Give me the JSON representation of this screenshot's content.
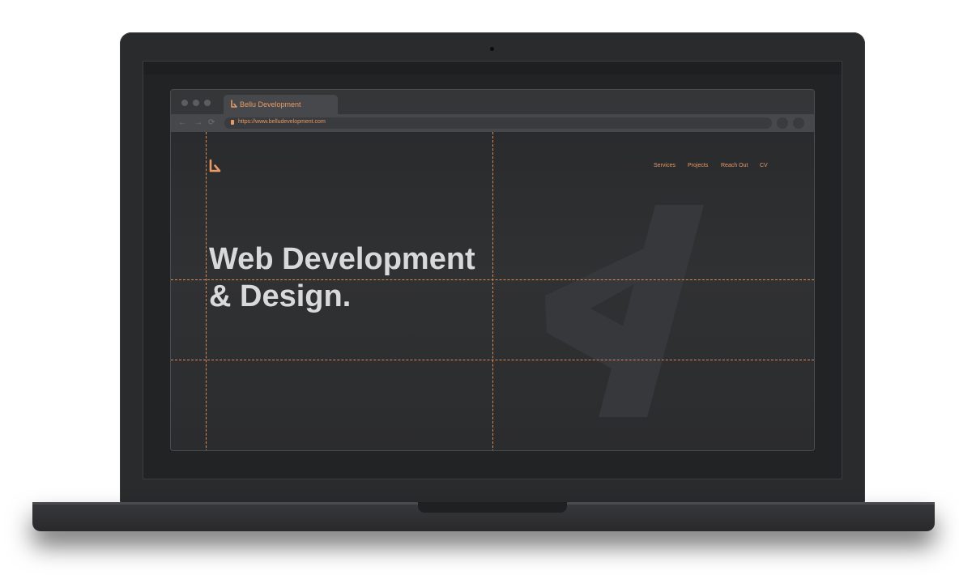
{
  "browser": {
    "tab": {
      "title": "Bellu Development",
      "icon": "bellu-logo-icon"
    },
    "address_bar": {
      "url": "https://www.belludevelopment.com"
    },
    "toolbar": {
      "back_icon": "←",
      "forward_icon": "→",
      "reload_icon": "⟳"
    }
  },
  "site": {
    "logo": "bellu-logo-icon",
    "nav": [
      {
        "label": "Services"
      },
      {
        "label": "Projects"
      },
      {
        "label": "Reach Out"
      },
      {
        "label": "CV"
      }
    ],
    "hero": {
      "line1": "Web Development",
      "line2": "& Design."
    },
    "background_icon": "code-slash-icon"
  },
  "colors": {
    "accent": "#e59a67",
    "background": "#2b2c2e",
    "hero_text": "#d9d9db"
  }
}
